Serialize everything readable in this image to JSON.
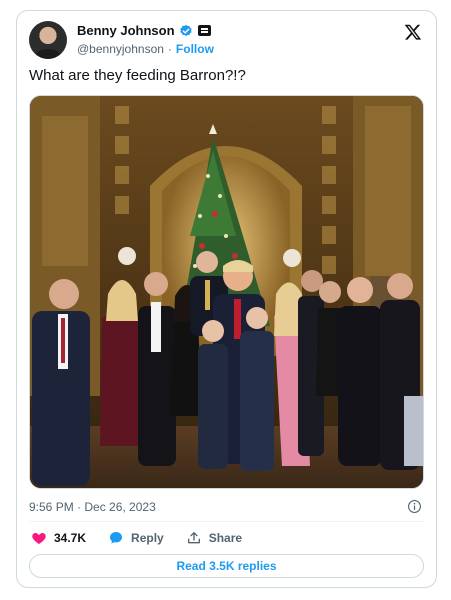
{
  "tweet": {
    "author_name": "Benny Johnson",
    "handle": "@bennyjohnson",
    "separator": "·",
    "follow_label": "Follow",
    "text": "What are they feeding Barron?!?",
    "timestamp": "9:56 PM · Dec 26, 2023",
    "likes": "34.7K",
    "reply_label": "Reply",
    "share_label": "Share",
    "read_replies_label": "Read 3.5K replies"
  },
  "icons": {
    "verified": "verified-badge-icon",
    "affiliate": "affiliate-badge-icon",
    "x_logo": "x-logo-icon",
    "info": "info-icon",
    "like": "heart-icon",
    "reply": "reply-bubble-icon",
    "share": "share-upload-icon"
  },
  "colors": {
    "accent": "#1d9bf0",
    "like": "#f91880",
    "muted": "#536471",
    "border": "#cfd9de"
  }
}
